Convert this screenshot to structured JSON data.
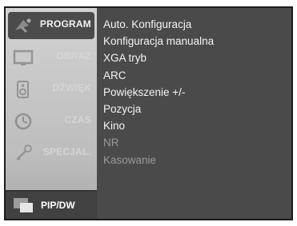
{
  "sidebar": {
    "tabs": [
      {
        "label": "PROGRAM",
        "icon": "satellite-dish-icon",
        "state": "active"
      },
      {
        "label": "OBRAZ",
        "icon": "monitor-icon",
        "state": "faded"
      },
      {
        "label": "DŹWIĘK",
        "icon": "speaker-icon",
        "state": "faded"
      },
      {
        "label": "CZAS",
        "icon": "clock-icon",
        "state": "faded"
      },
      {
        "label": "SPECJAL.",
        "icon": "key-icon",
        "state": "faded"
      }
    ],
    "bottom_tab": {
      "label": "PIP/DW",
      "icon": "pip-screens-icon"
    }
  },
  "menu": {
    "items": [
      {
        "label": "Auto. Konfiguracja",
        "enabled": true
      },
      {
        "label": "Konfiguracja manualna",
        "enabled": true
      },
      {
        "label": "XGA tryb",
        "enabled": true
      },
      {
        "label": "ARC",
        "enabled": true
      },
      {
        "label": "Powiększenie +/-",
        "enabled": true
      },
      {
        "label": "Pozycja",
        "enabled": true
      },
      {
        "label": "Kino",
        "enabled": true
      },
      {
        "label": "NR",
        "enabled": false
      },
      {
        "label": "Kasowanie",
        "enabled": false
      }
    ]
  },
  "colors": {
    "panel": "#4a4a4a",
    "sidebar": "#c8c8c8",
    "text": "#f4f4f4",
    "disabled_text": "#9a9a9a"
  }
}
